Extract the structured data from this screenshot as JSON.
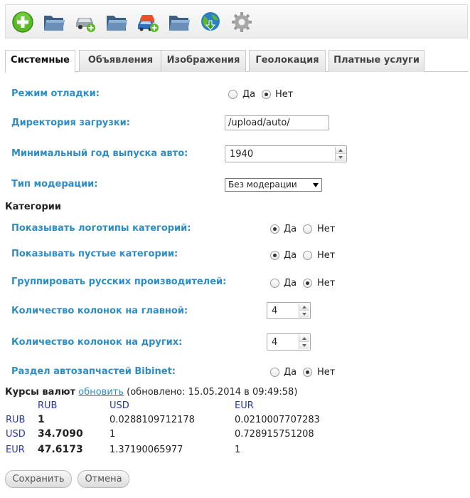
{
  "toolbar": {
    "buttons": [
      {
        "name": "add-icon"
      },
      {
        "name": "folder-icon"
      },
      {
        "name": "add-car-icon"
      },
      {
        "name": "folder-icon"
      },
      {
        "name": "add-cars-icon"
      },
      {
        "name": "folder-icon"
      },
      {
        "name": "globe-download-icon"
      },
      {
        "name": "gear-icon"
      }
    ]
  },
  "tabs": [
    "Системные",
    "Объявления",
    "Изображения",
    "Геолокация",
    "Платные услуги"
  ],
  "settings": {
    "debug_mode": {
      "label": "Режим отладки:",
      "yes": "Да",
      "no": "Нет"
    },
    "upload_dir": {
      "label": "Директория загрузки:",
      "value": "/upload/auto/"
    },
    "min_year": {
      "label": "Минимальный год выпуска авто:",
      "value": "1940"
    },
    "moderation": {
      "label": "Тип модерации:",
      "value": "Без модерации"
    }
  },
  "categories": {
    "title": "Категории",
    "show_logos": {
      "label": "Показывать логотипы категорий:",
      "yes": "Да",
      "no": "Нет"
    },
    "show_empty": {
      "label": "Показывать пустые категории:",
      "yes": "Да",
      "no": "Нет"
    },
    "group_russian": {
      "label": "Группировать русских производителей:",
      "yes": "Да",
      "no": "Нет"
    },
    "cols_main": {
      "label": "Количество колонок на главной:",
      "value": "4"
    },
    "cols_other": {
      "label": "Количество колонок на других:",
      "value": "4"
    },
    "bibinet": {
      "label": "Раздел автозапчастей Bibinet:",
      "yes": "Да",
      "no": "Нет"
    }
  },
  "rates": {
    "title": "Курсы валют",
    "refresh": "обновить",
    "updated": "(обновлено: 15.05.2014 в 09:49:58)",
    "headers": [
      "RUB",
      "USD",
      "EUR"
    ],
    "rows": [
      {
        "code": "RUB",
        "rub": "1",
        "usd": "0.0288109712178",
        "eur": "0.0210007707283"
      },
      {
        "code": "USD",
        "rub": "34.7090",
        "usd": "1",
        "eur": "0.728915751208"
      },
      {
        "code": "EUR",
        "rub": "47.6173",
        "usd": "1.37190065977",
        "eur": "1"
      }
    ]
  },
  "actions": {
    "save": "Сохранить",
    "cancel": "Отмена"
  }
}
